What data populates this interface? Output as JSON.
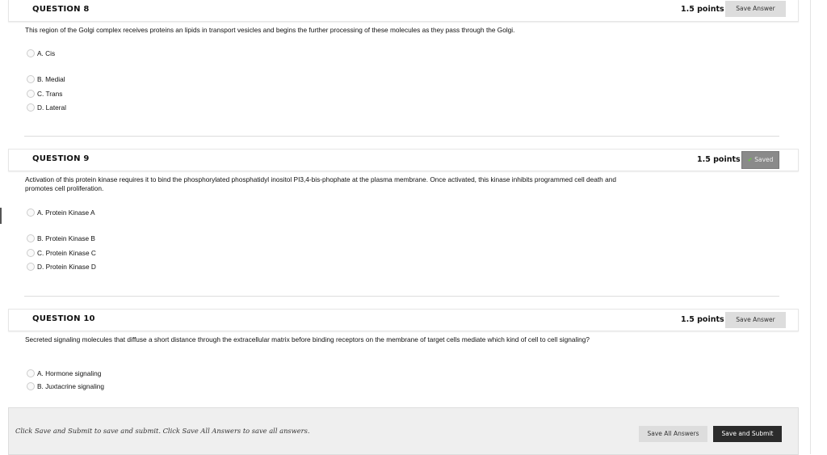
{
  "questions": [
    {
      "title": "QUESTION 8",
      "points": "1.5 points",
      "button": "Save Answer",
      "text": "This region of the Golgi complex receives proteins an lipids in transport vesicles and begins the further processing of these molecules as they pass through the Golgi.",
      "options": [
        "A. Cis",
        "B. Medial",
        "C. Trans",
        "D. Lateral"
      ]
    },
    {
      "title": "QUESTION 9",
      "points": "1.5 points",
      "button": "Saved",
      "button_icon": "check-icon",
      "text": "Activation of this protein kinase requires it to bind the phosphorylated phosphatidyl inositol PI3,4-bis-phophate at the plasma membrane. Once activated, this kinase inhibits programmed cell death and promotes cell proliferation.",
      "options": [
        "A. Protein Kinase A",
        "B. Protein Kinase B",
        "C. Protein Kinase C",
        "D. Protein Kinase D"
      ]
    },
    {
      "title": "QUESTION 10",
      "points": "1.5 points",
      "button": "Save Answer",
      "text": "Secreted signaling molecules that diffuse a short distance through the extracellular matrix before binding receptors on the membrane of target cells mediate which kind of cell to cell signaling?",
      "options": [
        "A. Hormone signaling",
        "B. Juxtacrine signaling"
      ]
    }
  ],
  "footer": {
    "text": "Click Save and Submit to save and submit. Click Save All Answers to save all answers.",
    "save_all": "Save All Answers",
    "save_submit": "Save and Submit"
  },
  "colors": {
    "saved": "#8a8a8a",
    "check": "#6cc644",
    "submit": "#2b2b2b"
  }
}
